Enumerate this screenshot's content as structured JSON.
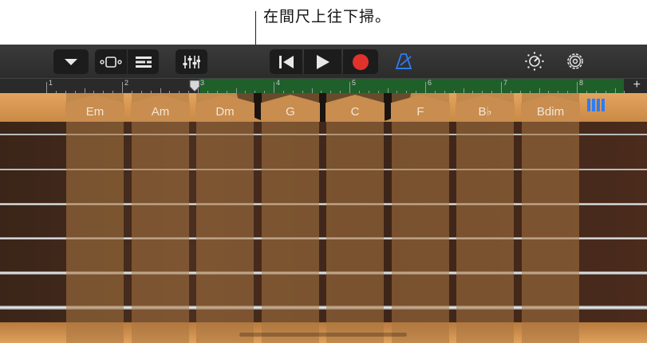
{
  "callout": {
    "text": "在間尺上往下掃。"
  },
  "toolbar": {
    "icons": [
      "chevron-down-icon",
      "tracks-view-icon",
      "list-view-icon",
      "mixer-icon",
      "rewind-icon",
      "play-icon",
      "record-icon",
      "metronome-icon",
      "brightness-icon",
      "gear-icon"
    ],
    "record_color": "#e0322b",
    "metronome_color": "#2e7cf6"
  },
  "ruler": {
    "bars": [
      "1",
      "2",
      "3",
      "4",
      "5",
      "6",
      "7",
      "8"
    ],
    "add_label": "+"
  },
  "chords": {
    "items": [
      "Em",
      "Am",
      "Dm",
      "G",
      "C",
      "F",
      "B♭",
      "Bdim"
    ]
  },
  "accent_color": "#2e7cf6"
}
